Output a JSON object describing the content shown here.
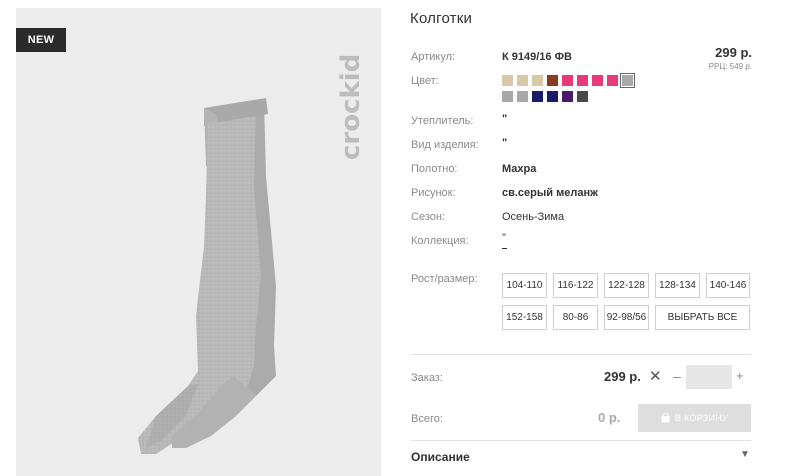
{
  "product": {
    "title": "Колготки",
    "badge": "NEW",
    "brand": "crockid",
    "price": "299 р.",
    "rrp": "РРЦ: 549 р."
  },
  "specs": {
    "article_label": "Артикул:",
    "article_value": "К 9149/16 ФВ",
    "color_label": "Цвет:",
    "insulation_label": "Утеплитель:",
    "insulation_value": "\"",
    "kind_label": "Вид изделия:",
    "kind_value": "\"",
    "fabric_label": "Полотно:",
    "fabric_value": "Махра",
    "pattern_label": "Рисунок:",
    "pattern_value": "св.серый меланж",
    "season_label": "Сезон:",
    "season_value": "Осень-Зима",
    "collection_label": "Коллекция:",
    "collection_value": "\""
  },
  "colors": {
    "swatches": [
      "#d9c8a8",
      "#d9c8a8",
      "#d9c8a8",
      "#8b3a1f",
      "#e83a7a",
      "#e83a7a",
      "#e83a7a",
      "#e83a7a",
      "#a8a8a8",
      "#a8a8a8",
      "#a8a8a8",
      "#1a1a6b",
      "#1a1a6b",
      "#4a1a6b",
      "#4a4a4a"
    ],
    "selected_index": 8
  },
  "sizes": {
    "label": "Рост/размер:",
    "options": [
      "104-110",
      "116-122",
      "122-128",
      "128-134",
      "140-146",
      "152-158",
      "80-86",
      "92-98/56"
    ],
    "select_all": "ВЫБРАТЬ ВСЕ"
  },
  "order": {
    "label": "Заказ:",
    "price": "299 р.",
    "remove": "✕",
    "minus": "–",
    "quantity": "",
    "plus": "+"
  },
  "total": {
    "label": "Всего:",
    "value": "0 р.",
    "cart_button": "В КОРЗИНУ"
  },
  "description": {
    "title": "Описание",
    "arrow": "▼"
  }
}
